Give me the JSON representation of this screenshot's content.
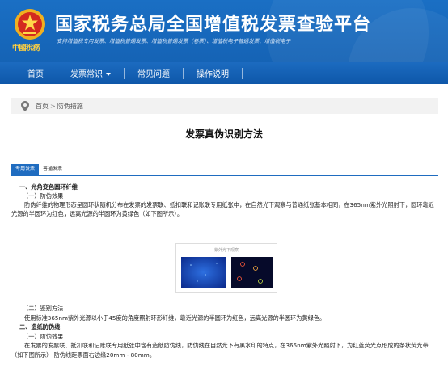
{
  "header": {
    "emblem_text": "中國稅務",
    "title": "国家税务总局全国增值税发票查验平台",
    "subtitle": "支持增值税专用发票、增值税普通发票、增值税普通发票（卷票）、增值税电子普通发票、增值税电子"
  },
  "nav": {
    "items": [
      "首页",
      "发票常识",
      "常见问题",
      "操作说明"
    ]
  },
  "breadcrumb": {
    "home": "首页",
    "separator": ">",
    "current": "防伪措施"
  },
  "page_title": "发票真伪识别方法",
  "tabs": [
    "专用发票",
    "普通发票"
  ],
  "content": {
    "section1_title": "一、光角变色圆环纤维",
    "sub1_title": "（一）防伪效果",
    "sub1_text": "防伪纤维的物理形态呈圆环状随机分布在发票的发票联、抵扣联和记账联专用纸张中，在自然光下观察与普通纸张基本相同，在365nm紫外光照射下，圆环靠近光源的半圆环为红色，远离光源的半圆环为黄绿色（如下图所示）。",
    "figure_caption": "紫外光下观察",
    "sub2_title": "（二）鉴别方法",
    "sub2_text": "使用标准365nm紫外光源以小于45度的角度照射环形纤维，靠近光源的半圆环为红色，远离光源的半圆环为黄绿色。",
    "section2_title": "二、造纸防伪线",
    "sub3_title": "（一）防伪效果",
    "sub3_text": "在发票的发票联、抵扣联和记账联专用纸张中含有造纸防伪线，防伪线在自然光下有黑水印的特点，在365nm紫外光照射下，为红蓝荧光点形成的条状荧光带（如下图所示）,防伪线距票面右边缘20mm - 80mm。"
  },
  "colors": {
    "header_blue": "#1565b8",
    "nav_blue": "#0e56a8",
    "tab_active": "#1f6cc0"
  }
}
